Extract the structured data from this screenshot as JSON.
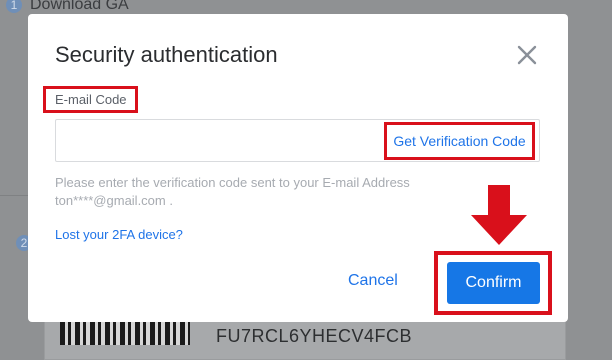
{
  "background": {
    "step1": {
      "number": "1",
      "title": "Download GA"
    },
    "step2": {
      "number": "2"
    },
    "secret_key": "FU7RCL6YHECV4FCB"
  },
  "modal": {
    "title": "Security authentication",
    "close_icon": "close-icon",
    "email_code_label": "E-mail Code",
    "code_input": {
      "value": "",
      "placeholder": ""
    },
    "get_code_label": "Get Verification Code",
    "hint_line1": "Please enter the verification code sent to your E-mail Address",
    "hint_line2": "ton****@gmail.com .",
    "lost_2fa_label": "Lost your 2FA device?",
    "cancel_label": "Cancel",
    "confirm_label": "Confirm"
  },
  "annotation": {
    "highlight_color": "#d9101b",
    "arrow_icon": "down-arrow-icon"
  },
  "colors": {
    "accent": "#1677e6",
    "link": "#1f74e8",
    "overlay": "#8f9193"
  }
}
